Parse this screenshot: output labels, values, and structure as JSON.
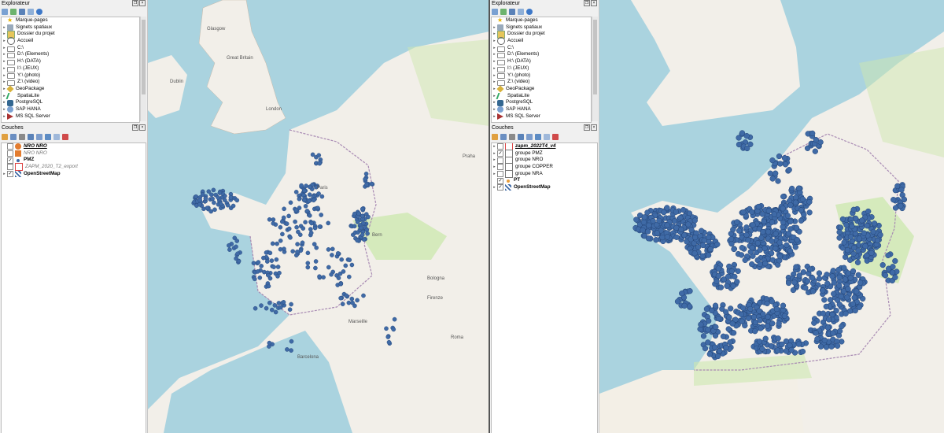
{
  "left_window": {
    "browser_panel": {
      "title": "Explorateur",
      "items": [
        {
          "label": "Marque-pages",
          "icon": "star-icon",
          "expander": false
        },
        {
          "label": "Signets spatiaux",
          "icon": "spatial-bookmark-icon",
          "expander": true
        },
        {
          "label": "Dossier du projet",
          "icon": "project-folder-icon",
          "expander": true
        },
        {
          "label": "Accueil",
          "icon": "home-icon",
          "expander": true
        },
        {
          "label": "C:\\",
          "icon": "folder-icon",
          "expander": true
        },
        {
          "label": "D:\\ (Elements)",
          "icon": "folder-icon",
          "expander": true
        },
        {
          "label": "H:\\ (DATA)",
          "icon": "folder-icon",
          "expander": true
        },
        {
          "label": "I:\\ (JEUX)",
          "icon": "folder-icon",
          "expander": true
        },
        {
          "label": "Y:\\ (photo)",
          "icon": "folder-icon",
          "expander": true
        },
        {
          "label": "Z:\\ (video)",
          "icon": "folder-icon",
          "expander": true
        },
        {
          "label": "GeoPackage",
          "icon": "geopackage-icon",
          "expander": true
        },
        {
          "label": "SpatiaLite",
          "icon": "spatialite-icon",
          "expander": true
        },
        {
          "label": "PostgreSQL",
          "icon": "postgresql-icon",
          "expander": true
        },
        {
          "label": "SAP HANA",
          "icon": "sap-hana-icon",
          "expander": true
        },
        {
          "label": "MS SQL Server",
          "icon": "mssql-icon",
          "expander": true
        }
      ]
    },
    "layers_panel": {
      "title": "Couches",
      "layers": [
        {
          "label": "NRO NRO",
          "checked": false,
          "style": "bold-italic-underline",
          "symbol": "orange-circle-icon",
          "expander": false,
          "indent": 0
        },
        {
          "label": "NRO NRO",
          "checked": false,
          "style": "italic-grey",
          "symbol": "orange-square-icon",
          "expander": false,
          "indent": 0
        },
        {
          "label": "PMZ",
          "checked": true,
          "style": "bold",
          "symbol": "blue-point-icon",
          "expander": false,
          "indent": 0
        },
        {
          "label": "ZAPM_2020_T2_export",
          "checked": false,
          "style": "italic-grey",
          "symbol": "polygon-outline-icon",
          "expander": false,
          "indent": 0
        },
        {
          "label": "OpenStreetMap",
          "checked": true,
          "style": "bold",
          "symbol": "raster-icon",
          "expander": true,
          "indent": 0
        }
      ]
    },
    "map_labels": [
      "Glasgow",
      "Great Britain",
      "Dublin",
      "Paris",
      "Bologna",
      "Firenze",
      "Praha",
      "Marseille",
      "Barcelona",
      "Roma",
      "Bern",
      "London"
    ]
  },
  "right_window": {
    "browser_panel": {
      "title": "Explorateur",
      "items": [
        {
          "label": "Marque-pages",
          "icon": "star-icon",
          "expander": false
        },
        {
          "label": "Signets spatiaux",
          "icon": "spatial-bookmark-icon",
          "expander": true
        },
        {
          "label": "Dossier du projet",
          "icon": "project-folder-icon",
          "expander": true
        },
        {
          "label": "Accueil",
          "icon": "home-icon",
          "expander": true
        },
        {
          "label": "C:\\",
          "icon": "folder-icon",
          "expander": true
        },
        {
          "label": "D:\\ (Elements)",
          "icon": "folder-icon",
          "expander": true
        },
        {
          "label": "H:\\ (DATA)",
          "icon": "folder-icon",
          "expander": true
        },
        {
          "label": "I:\\ (JEUX)",
          "icon": "folder-icon",
          "expander": true
        },
        {
          "label": "Y:\\ (photo)",
          "icon": "folder-icon",
          "expander": true
        },
        {
          "label": "Z:\\ (video)",
          "icon": "folder-icon",
          "expander": true
        },
        {
          "label": "GeoPackage",
          "icon": "geopackage-icon",
          "expander": true
        },
        {
          "label": "SpatiaLite",
          "icon": "spatialite-icon",
          "expander": true
        },
        {
          "label": "PostgreSQL",
          "icon": "postgresql-icon",
          "expander": true
        },
        {
          "label": "SAP HANA",
          "icon": "sap-hana-icon",
          "expander": true
        },
        {
          "label": "MS SQL Server",
          "icon": "mssql-icon",
          "expander": true
        }
      ]
    },
    "layers_panel": {
      "title": "Couches",
      "layers": [
        {
          "label": "zapm_2022T4_v4",
          "checked": false,
          "style": "bold-italic-underline",
          "symbol": "polygon-outline-icon",
          "expander": true,
          "indent": 0
        },
        {
          "label": "groupe PMZ",
          "checked": true,
          "style": "normal",
          "symbol": "group-icon",
          "expander": true,
          "indent": 0
        },
        {
          "label": "groupe NRO",
          "checked": false,
          "style": "normal",
          "symbol": "group-icon",
          "expander": true,
          "indent": 0
        },
        {
          "label": "groupe COPPER",
          "checked": false,
          "style": "normal",
          "symbol": "group-icon",
          "expander": true,
          "indent": 0
        },
        {
          "label": "groupe NRA",
          "checked": false,
          "style": "normal",
          "symbol": "group-icon",
          "expander": true,
          "indent": 0
        },
        {
          "label": "PT",
          "checked": true,
          "style": "bold",
          "symbol": "orange-dot-icon",
          "expander": false,
          "indent": 0
        },
        {
          "label": "OpenStreetMap",
          "checked": true,
          "style": "bold",
          "symbol": "raster-icon",
          "expander": true,
          "indent": 0
        }
      ]
    }
  },
  "colors": {
    "point_fill": "#3f6aa6",
    "point_stroke": "#234477",
    "sea": "#aad3df",
    "land": "#f2efe9",
    "green": "#cde8b0",
    "border": "#a88ab3"
  }
}
